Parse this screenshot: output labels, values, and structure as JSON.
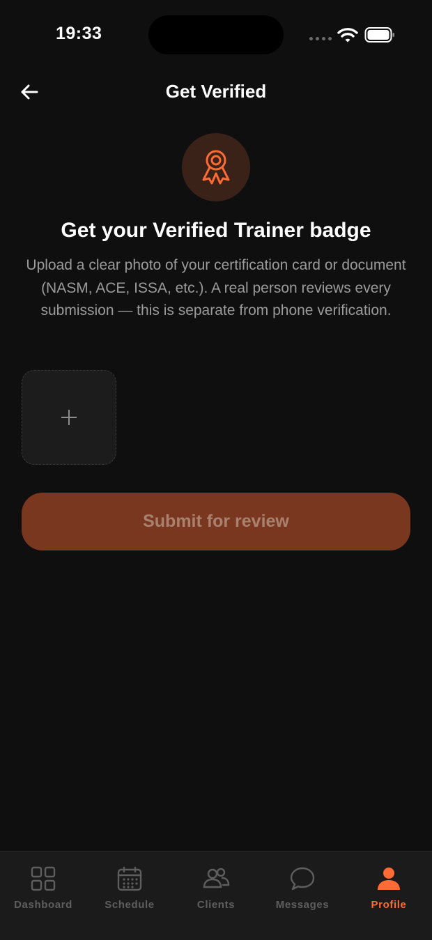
{
  "status_bar": {
    "time": "19:33"
  },
  "header": {
    "title": "Get Verified",
    "back_icon": "arrow-left-icon"
  },
  "hero": {
    "icon": "award-ribbon-icon",
    "title": "Get your Verified Trainer badge",
    "description": "Upload a clear photo of your certification card or document (NASM, ACE, ISSA, etc.). A real person reviews every submission — this is separate from phone verification."
  },
  "upload": {
    "icon": "plus-icon"
  },
  "submit": {
    "label": "Submit for review",
    "enabled": false
  },
  "tabbar": {
    "active": "Profile",
    "items": [
      {
        "label": "Dashboard",
        "icon": "grid-icon"
      },
      {
        "label": "Schedule",
        "icon": "calendar-icon"
      },
      {
        "label": "Clients",
        "icon": "users-icon"
      },
      {
        "label": "Messages",
        "icon": "chat-bubble-icon"
      },
      {
        "label": "Profile",
        "icon": "person-icon"
      }
    ]
  },
  "colors": {
    "background": "#0f0f0f",
    "accent": "#ff6b35",
    "accent_muted": "#7a3720",
    "text_secondary": "#9b9b9b",
    "tab_inactive": "#5e5e5e"
  }
}
